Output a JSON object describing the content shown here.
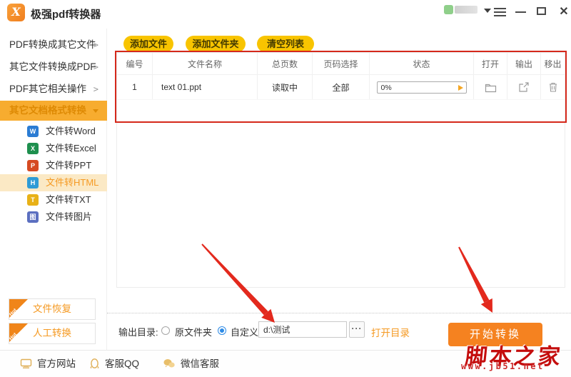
{
  "colors": {
    "accent_orange": "#F58220",
    "sidebar_active_orange": "#F7AC2F",
    "toolbar_yellow": "#F8C400",
    "link_orange": "#F59A23",
    "annotation_red": "#D5281B",
    "radio_blue": "#2E8BE6",
    "watermark_red": "#C40D0D"
  },
  "titlebar": {
    "app_name": "极强pdf转换器"
  },
  "sidebar": {
    "groups": [
      {
        "label": "PDF转换成其它文件",
        "chevron": ">"
      },
      {
        "label": "其它文件转换成PDF",
        "chevron": ">"
      },
      {
        "label": "PDF其它相关操作",
        "chevron": ">"
      },
      {
        "label": "其它文档格式转换"
      }
    ],
    "items": [
      {
        "label": "文件转Word",
        "badge": "W"
      },
      {
        "label": "文件转Excel",
        "badge": "X"
      },
      {
        "label": "文件转PPT",
        "badge": "P"
      },
      {
        "label": "文件转HTML",
        "badge": "H"
      },
      {
        "label": "文件转TXT",
        "badge": "T"
      },
      {
        "label": "文件转图片",
        "badge": "图"
      }
    ],
    "promos": [
      {
        "label": "文件恢复",
        "badge": "Hot"
      },
      {
        "label": "人工转换",
        "badge": "Hot"
      }
    ]
  },
  "toolbar": {
    "add_file": "添加文件",
    "add_folder": "添加文件夹",
    "clear_list": "清空列表"
  },
  "table": {
    "columns": [
      "编号",
      "文件名称",
      "总页数",
      "页码选择",
      "状态",
      "打开",
      "输出",
      "移出"
    ],
    "rows": [
      {
        "index": "1",
        "filename": "text 01.ppt",
        "pages": "读取中",
        "page_select": "全部",
        "progress": "0%"
      }
    ]
  },
  "output_bar": {
    "label": "输出目录:",
    "radio_original": "原文件夹",
    "radio_custom": "自定义",
    "path_value": "d:\\测试",
    "browse": "···",
    "open_dir": "打开目录",
    "start": "开始转换"
  },
  "footer": {
    "items": [
      {
        "label": "官方网站"
      },
      {
        "label": "客服QQ"
      },
      {
        "label": "微信客服"
      }
    ]
  },
  "watermark": {
    "title": "脚本之家",
    "url": "www.jb51.net"
  }
}
